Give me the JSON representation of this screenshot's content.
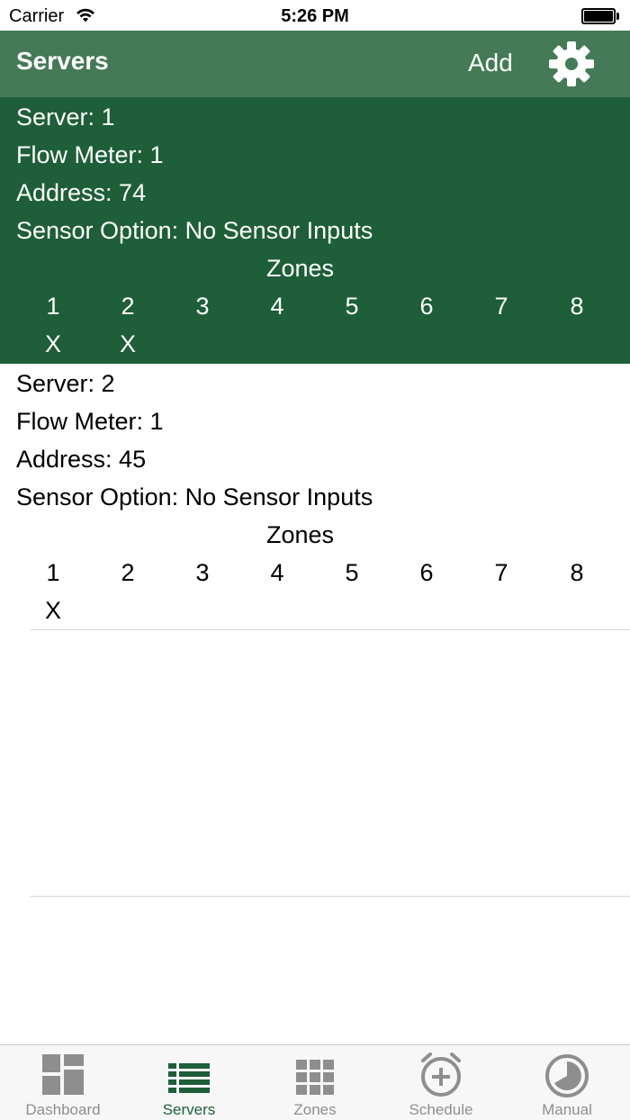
{
  "status_bar": {
    "carrier": "Carrier",
    "time": "5:26 PM"
  },
  "nav": {
    "title": "Servers",
    "add_label": "Add",
    "settings_icon": "gear-icon"
  },
  "colors": {
    "nav_bar": "#447a56",
    "selected_row": "#1e5e38",
    "tab_active": "#1e5e38",
    "tab_inactive": "#8e8e8e"
  },
  "servers": [
    {
      "server": "Server: 1",
      "flow_meter": "Flow Meter: 1",
      "address": "Address: 74",
      "sensor_option": "Sensor Option: No Sensor Inputs",
      "zones_title": "Zones",
      "zone_numbers": [
        "1",
        "2",
        "3",
        "4",
        "5",
        "6",
        "7",
        "8"
      ],
      "zone_marks": [
        "X",
        "X",
        "",
        "",
        "",
        "",
        "",
        ""
      ],
      "selected": true
    },
    {
      "server": "Server: 2",
      "flow_meter": "Flow Meter: 1",
      "address": "Address: 45",
      "sensor_option": "Sensor Option: No Sensor Inputs",
      "zones_title": "Zones",
      "zone_numbers": [
        "1",
        "2",
        "3",
        "4",
        "5",
        "6",
        "7",
        "8"
      ],
      "zone_marks": [
        "X",
        "",
        "",
        "",
        "",
        "",
        "",
        ""
      ],
      "selected": false
    }
  ],
  "tabs": [
    {
      "label": "Dashboard",
      "icon": "dashboard-icon",
      "active": false
    },
    {
      "label": "Servers",
      "icon": "list-icon",
      "active": true
    },
    {
      "label": "Zones",
      "icon": "grid-icon",
      "active": false
    },
    {
      "label": "Schedule",
      "icon": "alarm-clock-icon",
      "active": false
    },
    {
      "label": "Manual",
      "icon": "pie-dial-icon",
      "active": false
    }
  ]
}
